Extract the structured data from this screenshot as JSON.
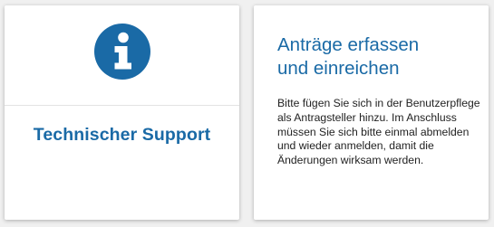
{
  "cards": [
    {
      "icon": "info-icon",
      "title": "Technischer Support"
    },
    {
      "title_line1": "Anträge erfassen",
      "title_line2": "und einreichen",
      "text": "Bitte fügen Sie sich in der Benutzerpflege als Antragsteller hinzu. Im Anschluss müssen Sie sich bitte einmal abmelden und wieder anmelden, damit die Änderungen wirksam werden."
    }
  ],
  "colors": {
    "accent": "#1a6aa6",
    "icon": "#1a6aa6",
    "text": "#222222",
    "background": "#f0f0f0",
    "card": "#ffffff"
  }
}
